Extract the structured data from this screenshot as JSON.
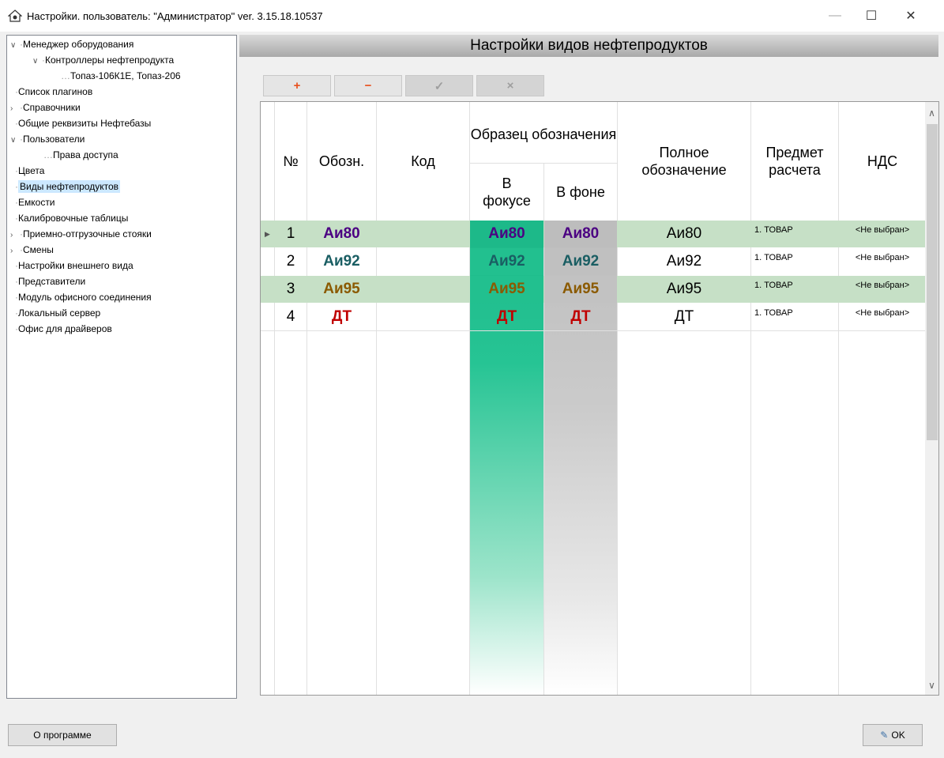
{
  "window": {
    "title": "Настройки. пользователь: \"Администратор\" ver. 3.15.18.10537",
    "minimize": "—",
    "maximize": "☐",
    "close": "✕"
  },
  "tree": [
    {
      "label": "Менеджер оборудования",
      "arrow": "expanded"
    },
    {
      "label": "Контроллеры нефтепродукта",
      "arrow": "expanded"
    },
    {
      "label": "Топаз-106К1Е, Топаз-206"
    },
    {
      "label": "Список плагинов"
    },
    {
      "label": "Справочники",
      "arrow": "collapsed"
    },
    {
      "label": "Общие реквизиты Нефтебазы"
    },
    {
      "label": "Пользователи",
      "arrow": "expanded"
    },
    {
      "label": "Права доступа"
    },
    {
      "label": "Цвета"
    },
    {
      "label": "Виды нефтепродуктов",
      "selected": true
    },
    {
      "label": "Емкости"
    },
    {
      "label": "Калибровочные таблицы"
    },
    {
      "label": "Приемно-отгрузочные стояки",
      "arrow": "collapsed"
    },
    {
      "label": "Смены",
      "arrow": "collapsed"
    },
    {
      "label": "Настройки внешнего вида"
    },
    {
      "label": "Представители"
    },
    {
      "label": "Модуль офисного соединения"
    },
    {
      "label": "Локальный сервер"
    },
    {
      "label": "Офис для драйверов"
    }
  ],
  "panel_title": "Настройки видов нефтепродуктов",
  "toolbar": {
    "add": "+",
    "remove": "−",
    "apply": "✓",
    "cancel": "×"
  },
  "grid": {
    "headers": {
      "num": "№",
      "abbr": "Обозн.",
      "code": "Код",
      "sample": "Образец обозначения",
      "focus": "В фокусе",
      "bg": "В фоне",
      "full": "Полное обозначение",
      "subject": "Предмет расчета",
      "vat": "НДС"
    },
    "rows": [
      {
        "num": "1",
        "abbr": "Аи80",
        "code": "",
        "focus": "Аи80",
        "bg": "Аи80",
        "full": "Аи80",
        "subject": "1. ТОВАР",
        "vat": "<Не выбран>",
        "color": "#4b0082",
        "row_bg": "#c6e0c6",
        "current": true
      },
      {
        "num": "2",
        "abbr": "Аи92",
        "code": "",
        "focus": "Аи92",
        "bg": "Аи92",
        "full": "Аи92",
        "subject": "1. ТОВАР",
        "vat": "<Не выбран>",
        "color": "#1a5e63",
        "row_bg": "#ffffff"
      },
      {
        "num": "3",
        "abbr": "Аи95",
        "code": "",
        "focus": "Аи95",
        "bg": "Аи95",
        "full": "Аи95",
        "subject": "1. ТОВАР",
        "vat": "<Не выбран>",
        "color": "#8b5a00",
        "row_bg": "#c6e0c6"
      },
      {
        "num": "4",
        "abbr": "ДТ",
        "code": "",
        "focus": "ДТ",
        "bg": "ДТ",
        "full": "ДТ",
        "subject": "1. ТОВАР",
        "vat": "<Не выбран>",
        "color": "#c00000",
        "row_bg": "#ffffff"
      }
    ]
  },
  "buttons": {
    "about": "О программе",
    "ok": "OK"
  },
  "icons": {
    "ok_icon": "✎"
  }
}
